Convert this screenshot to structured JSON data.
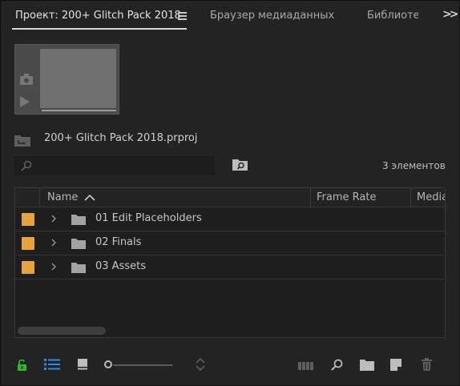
{
  "tabs": [
    {
      "label": "Проект: 200+ Glitch Pack 2018",
      "active": true
    },
    {
      "label": "Браузер медиаданных",
      "active": false
    },
    {
      "label": "Библиотеки",
      "active": false
    }
  ],
  "project": {
    "file_name": "200+ Glitch Pack 2018.prproj",
    "item_count": "3 элементов"
  },
  "search": {
    "value": "",
    "placeholder": ""
  },
  "table": {
    "columns": [
      "Name",
      "Frame Rate",
      "Media"
    ],
    "sort": "ascending",
    "rows": [
      {
        "label": "01 Edit Placeholders",
        "color": "#e8a33c",
        "type": "folder"
      },
      {
        "label": "02 Finals",
        "color": "#e8a33c",
        "type": "folder"
      },
      {
        "label": "03 Assets",
        "color": "#e8a33c",
        "type": "folder"
      }
    ]
  },
  "toolbar": {
    "icons": [
      "lock-open-icon",
      "list-view-icon",
      "icon-view-icon",
      "zoom-slider",
      "sort-icons-icon",
      "automate-sequence-icon",
      "find-icon",
      "new-bin-icon",
      "new-item-icon",
      "trash-icon"
    ],
    "lock_color": "#2eb82e",
    "active_color": "#2d8ceb"
  }
}
